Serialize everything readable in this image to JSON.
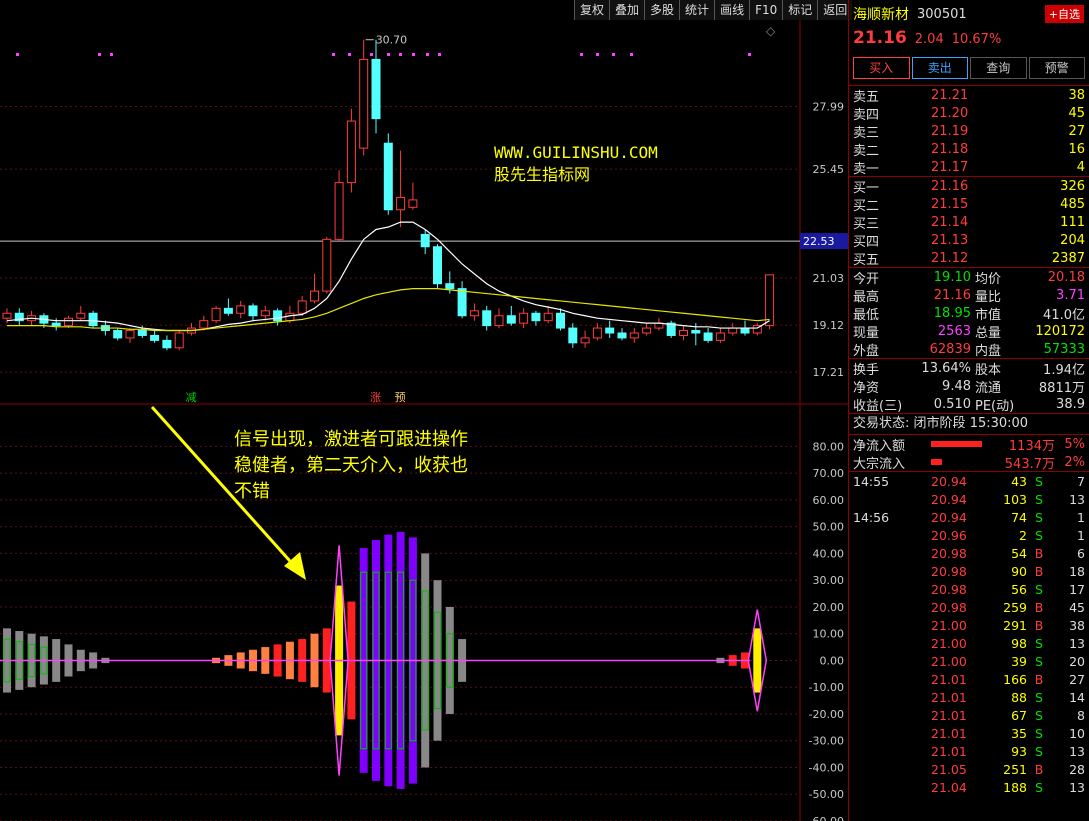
{
  "toolbar": {
    "items": [
      "复权",
      "叠加",
      "多股",
      "统计",
      "画线",
      "F10",
      "标记",
      "返回"
    ]
  },
  "stock": {
    "name": "海顺新材",
    "code": "300501",
    "add_watch": "+自选",
    "price": "21.16",
    "change": "2.04",
    "change_pct": "10.67%"
  },
  "actions": {
    "buy": "买入",
    "sell": "卖出",
    "query": "查询",
    "alert": "预警"
  },
  "order_book": {
    "asks": [
      {
        "label": "卖五",
        "price": "21.21",
        "vol": "38"
      },
      {
        "label": "卖四",
        "price": "21.20",
        "vol": "45"
      },
      {
        "label": "卖三",
        "price": "21.19",
        "vol": "27"
      },
      {
        "label": "卖二",
        "price": "21.18",
        "vol": "16"
      },
      {
        "label": "卖一",
        "price": "21.17",
        "vol": "4"
      }
    ],
    "bids": [
      {
        "label": "买一",
        "price": "21.16",
        "vol": "326"
      },
      {
        "label": "买二",
        "price": "21.15",
        "vol": "485"
      },
      {
        "label": "买三",
        "price": "21.14",
        "vol": "111"
      },
      {
        "label": "买四",
        "price": "21.13",
        "vol": "204"
      },
      {
        "label": "买五",
        "price": "21.12",
        "vol": "2387"
      }
    ]
  },
  "quote": [
    {
      "k1": "今开",
      "v1": "19.10",
      "c1": "grn",
      "k2": "均价",
      "v2": "20.18",
      "c2": "red"
    },
    {
      "k1": "最高",
      "v1": "21.16",
      "c1": "red",
      "k2": "量比",
      "v2": "3.71",
      "c2": "mag"
    },
    {
      "k1": "最低",
      "v1": "18.95",
      "c1": "grn",
      "k2": "市值",
      "v2": "41.0亿",
      "c2": "wht"
    },
    {
      "k1": "现量",
      "v1": "2563",
      "c1": "mag",
      "k2": "总量",
      "v2": "120172",
      "c2": "yel"
    },
    {
      "k1": "外盘",
      "v1": "62839",
      "c1": "red",
      "k2": "内盘",
      "v2": "57333",
      "c2": "grn"
    }
  ],
  "fundamentals": [
    {
      "k1": "换手",
      "v1": "13.64%",
      "k2": "股本",
      "v2": "1.94亿"
    },
    {
      "k1": "净资",
      "v1": "9.48",
      "k2": "流通",
      "v2": "8811万"
    },
    {
      "k1": "收益(三)",
      "v1": "0.510",
      "k2": "PE(动)",
      "v2": "38.9"
    }
  ],
  "trade_status": {
    "label": "交易状态:",
    "value": "闭市阶段",
    "time": "15:30:00"
  },
  "flows": [
    {
      "label": "净流入额",
      "value": "1134万",
      "pct": "5%",
      "bar": 0.85
    },
    {
      "label": "大宗流入",
      "value": "543.7万",
      "pct": "2%",
      "bar": 0.18
    }
  ],
  "ticks": [
    {
      "t": "14:55",
      "p": "20.94",
      "v": "43",
      "s": "S",
      "n": "7"
    },
    {
      "t": "",
      "p": "20.94",
      "v": "103",
      "s": "S",
      "n": "13"
    },
    {
      "t": "14:56",
      "p": "20.94",
      "v": "74",
      "s": "S",
      "n": "1"
    },
    {
      "t": "",
      "p": "20.96",
      "v": "2",
      "s": "S",
      "n": "1"
    },
    {
      "t": "",
      "p": "20.98",
      "v": "54",
      "s": "B",
      "n": "6"
    },
    {
      "t": "",
      "p": "20.98",
      "v": "90",
      "s": "B",
      "n": "18"
    },
    {
      "t": "",
      "p": "20.98",
      "v": "56",
      "s": "S",
      "n": "17"
    },
    {
      "t": "",
      "p": "20.98",
      "v": "259",
      "s": "B",
      "n": "45"
    },
    {
      "t": "",
      "p": "21.00",
      "v": "291",
      "s": "B",
      "n": "38"
    },
    {
      "t": "",
      "p": "21.00",
      "v": "98",
      "s": "S",
      "n": "13"
    },
    {
      "t": "",
      "p": "21.00",
      "v": "39",
      "s": "S",
      "n": "20"
    },
    {
      "t": "",
      "p": "21.01",
      "v": "166",
      "s": "B",
      "n": "27"
    },
    {
      "t": "",
      "p": "21.01",
      "v": "88",
      "s": "S",
      "n": "14"
    },
    {
      "t": "",
      "p": "21.01",
      "v": "67",
      "s": "S",
      "n": "8"
    },
    {
      "t": "",
      "p": "21.01",
      "v": "35",
      "s": "S",
      "n": "10"
    },
    {
      "t": "",
      "p": "21.01",
      "v": "93",
      "s": "S",
      "n": "13"
    },
    {
      "t": "",
      "p": "21.05",
      "v": "251",
      "s": "B",
      "n": "28"
    },
    {
      "t": "",
      "p": "21.04",
      "v": "188",
      "s": "S",
      "n": "13"
    }
  ],
  "annotations": {
    "site": "WWW.GUILINSHU.COM",
    "site_name": "股先生指标网",
    "note_lines": [
      "信号出现，激进者可跟进操作",
      "稳健者，第二天介入，收获也",
      "不错"
    ]
  },
  "chart_data": [
    {
      "type": "candlestick",
      "y_ticks": [
        "27.99",
        "25.45",
        "21.03",
        "19.12",
        "17.21"
      ],
      "y_tick_values": [
        27.99,
        25.45,
        21.03,
        19.12,
        17.21
      ],
      "ylim": [
        16.0,
        31.5
      ],
      "crosshair_label": "22.53",
      "crosshair_value": 22.53,
      "max_label": "30.70",
      "signal_labels": [
        {
          "i": 15,
          "text": "减"
        },
        {
          "i": 30,
          "text": "涨"
        },
        {
          "i": 32,
          "text": "预"
        }
      ],
      "candles": [
        {
          "o": 19.4,
          "c": 19.6,
          "h": 19.8,
          "l": 19.2
        },
        {
          "o": 19.6,
          "c": 19.3,
          "h": 19.8,
          "l": 19.1
        },
        {
          "o": 19.3,
          "c": 19.5,
          "h": 19.7,
          "l": 19.1
        },
        {
          "o": 19.5,
          "c": 19.2,
          "h": 19.6,
          "l": 19.0
        },
        {
          "o": 19.2,
          "c": 19.1,
          "h": 19.4,
          "l": 18.9
        },
        {
          "o": 19.1,
          "c": 19.4,
          "h": 19.5,
          "l": 19.0
        },
        {
          "o": 19.4,
          "c": 19.6,
          "h": 19.9,
          "l": 19.3
        },
        {
          "o": 19.6,
          "c": 19.1,
          "h": 19.7,
          "l": 19.0
        },
        {
          "o": 19.1,
          "c": 18.9,
          "h": 19.3,
          "l": 18.7
        },
        {
          "o": 18.9,
          "c": 18.6,
          "h": 19.0,
          "l": 18.5
        },
        {
          "o": 18.6,
          "c": 18.9,
          "h": 19.0,
          "l": 18.4
        },
        {
          "o": 18.9,
          "c": 18.7,
          "h": 19.1,
          "l": 18.6
        },
        {
          "o": 18.7,
          "c": 18.5,
          "h": 18.9,
          "l": 18.4
        },
        {
          "o": 18.5,
          "c": 18.2,
          "h": 18.7,
          "l": 18.1
        },
        {
          "o": 18.2,
          "c": 18.8,
          "h": 18.9,
          "l": 18.1
        },
        {
          "o": 18.8,
          "c": 19.0,
          "h": 19.2,
          "l": 18.7
        },
        {
          "o": 19.0,
          "c": 19.3,
          "h": 19.5,
          "l": 18.9
        },
        {
          "o": 19.3,
          "c": 19.8,
          "h": 19.9,
          "l": 19.2
        },
        {
          "o": 19.8,
          "c": 19.6,
          "h": 20.2,
          "l": 19.5
        },
        {
          "o": 19.6,
          "c": 19.9,
          "h": 20.1,
          "l": 19.4
        },
        {
          "o": 19.9,
          "c": 19.5,
          "h": 20.0,
          "l": 19.3
        },
        {
          "o": 19.5,
          "c": 19.7,
          "h": 19.9,
          "l": 19.3
        },
        {
          "o": 19.7,
          "c": 19.3,
          "h": 19.8,
          "l": 19.1
        },
        {
          "o": 19.3,
          "c": 19.6,
          "h": 19.9,
          "l": 19.2
        },
        {
          "o": 19.6,
          "c": 20.1,
          "h": 20.3,
          "l": 19.5
        },
        {
          "o": 20.1,
          "c": 20.5,
          "h": 21.2,
          "l": 20.0
        },
        {
          "o": 20.5,
          "c": 22.6,
          "h": 22.7,
          "l": 20.4
        },
        {
          "o": 22.6,
          "c": 24.9,
          "h": 25.4,
          "l": 22.5
        },
        {
          "o": 24.9,
          "c": 27.4,
          "h": 27.9,
          "l": 24.5
        },
        {
          "o": 26.3,
          "c": 29.9,
          "h": 30.7,
          "l": 26.0
        },
        {
          "o": 29.9,
          "c": 27.5,
          "h": 30.7,
          "l": 26.9
        },
        {
          "o": 26.5,
          "c": 23.8,
          "h": 26.9,
          "l": 23.6
        },
        {
          "o": 23.8,
          "c": 24.3,
          "h": 26.2,
          "l": 23.1
        },
        {
          "o": 23.9,
          "c": 24.2,
          "h": 24.9,
          "l": 23.8
        },
        {
          "o": 22.8,
          "c": 22.3,
          "h": 23.0,
          "l": 22.0
        },
        {
          "o": 22.3,
          "c": 20.8,
          "h": 22.4,
          "l": 20.6
        },
        {
          "o": 20.8,
          "c": 20.6,
          "h": 21.3,
          "l": 20.4
        },
        {
          "o": 20.6,
          "c": 19.5,
          "h": 20.9,
          "l": 19.4
        },
        {
          "o": 19.5,
          "c": 19.7,
          "h": 20.0,
          "l": 19.3
        },
        {
          "o": 19.7,
          "c": 19.1,
          "h": 19.9,
          "l": 18.9
        },
        {
          "o": 19.1,
          "c": 19.5,
          "h": 19.8,
          "l": 19.0
        },
        {
          "o": 19.5,
          "c": 19.2,
          "h": 19.9,
          "l": 19.1
        },
        {
          "o": 19.2,
          "c": 19.6,
          "h": 19.8,
          "l": 19.0
        },
        {
          "o": 19.6,
          "c": 19.3,
          "h": 19.7,
          "l": 19.1
        },
        {
          "o": 19.3,
          "c": 19.6,
          "h": 19.9,
          "l": 19.2
        },
        {
          "o": 19.6,
          "c": 19.0,
          "h": 19.8,
          "l": 18.9
        },
        {
          "o": 19.0,
          "c": 18.4,
          "h": 19.2,
          "l": 18.2
        },
        {
          "o": 18.4,
          "c": 18.6,
          "h": 18.9,
          "l": 18.2
        },
        {
          "o": 18.6,
          "c": 19.0,
          "h": 19.2,
          "l": 18.5
        },
        {
          "o": 19.0,
          "c": 18.8,
          "h": 19.3,
          "l": 18.6
        },
        {
          "o": 18.8,
          "c": 18.6,
          "h": 19.0,
          "l": 18.5
        },
        {
          "o": 18.6,
          "c": 18.8,
          "h": 19.0,
          "l": 18.4
        },
        {
          "o": 18.8,
          "c": 19.0,
          "h": 19.2,
          "l": 18.7
        },
        {
          "o": 19.0,
          "c": 19.2,
          "h": 19.4,
          "l": 18.9
        },
        {
          "o": 19.2,
          "c": 18.7,
          "h": 19.3,
          "l": 18.6
        },
        {
          "o": 18.7,
          "c": 18.9,
          "h": 19.1,
          "l": 18.5
        },
        {
          "o": 18.9,
          "c": 18.8,
          "h": 19.2,
          "l": 18.3
        },
        {
          "o": 18.8,
          "c": 18.5,
          "h": 19.0,
          "l": 18.4
        },
        {
          "o": 18.5,
          "c": 18.8,
          "h": 19.0,
          "l": 18.4
        },
        {
          "o": 18.8,
          "c": 19.0,
          "h": 19.2,
          "l": 18.7
        },
        {
          "o": 19.0,
          "c": 18.8,
          "h": 19.3,
          "l": 18.7
        },
        {
          "o": 18.8,
          "c": 19.1,
          "h": 19.2,
          "l": 18.7
        },
        {
          "o": 19.1,
          "c": 21.16,
          "h": 21.16,
          "l": 18.95
        }
      ],
      "ma_white": [
        19.3,
        19.35,
        19.4,
        19.35,
        19.3,
        19.3,
        19.3,
        19.3,
        19.25,
        19.2,
        19.1,
        19.0,
        18.95,
        18.9,
        18.9,
        18.9,
        18.95,
        19.05,
        19.15,
        19.2,
        19.3,
        19.35,
        19.4,
        19.5,
        19.55,
        19.8,
        20.2,
        20.9,
        21.8,
        22.6,
        23.0,
        23.1,
        23.3,
        23.3,
        23.0,
        22.6,
        22.1,
        21.6,
        21.2,
        20.8,
        20.5,
        20.3,
        20.1,
        19.95,
        19.85,
        19.75,
        19.6,
        19.5,
        19.4,
        19.35,
        19.3,
        19.25,
        19.2,
        19.2,
        19.15,
        19.1,
        19.05,
        19.05,
        19.0,
        19.0,
        19.0,
        19.0,
        19.3
      ],
      "ma_yellow": [
        19.1,
        19.1,
        19.1,
        19.1,
        19.05,
        19.05,
        19.05,
        19.0,
        19.0,
        19.0,
        18.95,
        18.95,
        18.9,
        18.9,
        18.9,
        18.9,
        18.95,
        19.0,
        19.05,
        19.1,
        19.15,
        19.2,
        19.25,
        19.3,
        19.35,
        19.45,
        19.6,
        19.8,
        20.0,
        20.2,
        20.35,
        20.45,
        20.55,
        20.6,
        20.6,
        20.6,
        20.55,
        20.5,
        20.45,
        20.4,
        20.35,
        20.3,
        20.25,
        20.2,
        20.15,
        20.1,
        20.05,
        20.0,
        19.95,
        19.9,
        19.85,
        19.8,
        19.75,
        19.7,
        19.65,
        19.6,
        19.55,
        19.5,
        19.45,
        19.4,
        19.35,
        19.3,
        19.35
      ]
    },
    {
      "type": "bar",
      "y_ticks": [
        "80.00",
        "70.00",
        "60.00",
        "50.00",
        "40.00",
        "30.00",
        "20.00",
        "10.00",
        "0.00",
        "-10.00",
        "-20.00",
        "-30.00",
        "-40.00",
        "-50.00",
        "-60.00"
      ],
      "y_tick_values": [
        80,
        70,
        60,
        50,
        40,
        30,
        20,
        10,
        0,
        -10,
        -20,
        -30,
        -40,
        -50,
        -60
      ],
      "ylim": [
        -60,
        88
      ],
      "bars": [
        {
          "i": 0,
          "v": 12,
          "c": "gray"
        },
        {
          "i": 1,
          "v": 11,
          "c": "gray"
        },
        {
          "i": 2,
          "v": 10,
          "c": "gray"
        },
        {
          "i": 3,
          "v": 9,
          "c": "gray"
        },
        {
          "i": 4,
          "v": 8,
          "c": "gray"
        },
        {
          "i": 5,
          "v": 6,
          "c": "gray"
        },
        {
          "i": 6,
          "v": 4,
          "c": "gray"
        },
        {
          "i": 7,
          "v": 3,
          "c": "gray"
        },
        {
          "i": 8,
          "v": 1,
          "c": "gray"
        },
        {
          "i": 17,
          "v": 1,
          "c": "orange"
        },
        {
          "i": 18,
          "v": 2,
          "c": "orange"
        },
        {
          "i": 19,
          "v": 3,
          "c": "orange"
        },
        {
          "i": 20,
          "v": 4,
          "c": "orange"
        },
        {
          "i": 21,
          "v": 5,
          "c": "orange"
        },
        {
          "i": 22,
          "v": 6,
          "c": "red"
        },
        {
          "i": 23,
          "v": 7,
          "c": "orange"
        },
        {
          "i": 24,
          "v": 8,
          "c": "red"
        },
        {
          "i": 25,
          "v": 10,
          "c": "orange"
        },
        {
          "i": 26,
          "v": 12,
          "c": "red"
        },
        {
          "i": 27,
          "v": 28,
          "c": "yellow"
        },
        {
          "i": 28,
          "v": 22,
          "c": "red"
        },
        {
          "i": 29,
          "v": 42,
          "c": "purple"
        },
        {
          "i": 30,
          "v": 45,
          "c": "purple"
        },
        {
          "i": 31,
          "v": 47,
          "c": "purple"
        },
        {
          "i": 32,
          "v": 48,
          "c": "purple"
        },
        {
          "i": 33,
          "v": 46,
          "c": "purple"
        },
        {
          "i": 34,
          "v": 40,
          "c": "gray"
        },
        {
          "i": 35,
          "v": 30,
          "c": "gray"
        },
        {
          "i": 36,
          "v": 20,
          "c": "gray"
        },
        {
          "i": 37,
          "v": 8,
          "c": "gray"
        },
        {
          "i": 58,
          "v": 1,
          "c": "gray"
        },
        {
          "i": 59,
          "v": 2,
          "c": "red"
        },
        {
          "i": 60,
          "v": 3,
          "c": "red"
        },
        {
          "i": 61,
          "v": 12,
          "c": "yellow"
        }
      ],
      "green_bars": [
        {
          "i": 29,
          "v": 33
        },
        {
          "i": 30,
          "v": 33
        },
        {
          "i": 31,
          "v": 33
        },
        {
          "i": 32,
          "v": 33
        },
        {
          "i": 33,
          "v": 30
        },
        {
          "i": 34,
          "v": 26
        },
        {
          "i": 35,
          "v": 18
        },
        {
          "i": 36,
          "v": 10
        },
        {
          "i": 0,
          "v": 8
        },
        {
          "i": 1,
          "v": 7
        },
        {
          "i": 2,
          "v": 6
        },
        {
          "i": 3,
          "v": 5
        }
      ],
      "signals": [
        {
          "i": 27,
          "v": 43
        },
        {
          "i": 61,
          "v": 19
        }
      ]
    }
  ]
}
